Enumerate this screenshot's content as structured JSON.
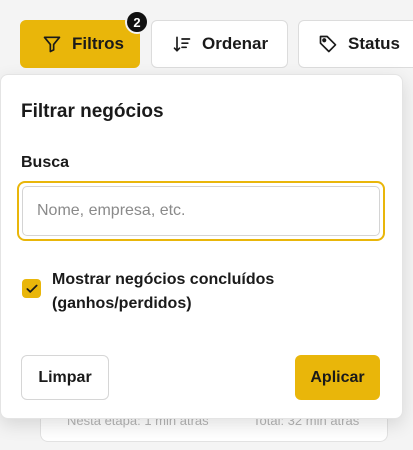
{
  "colors": {
    "accent": "#e9b60a",
    "badge": "#111111",
    "background": "#f4f4f4"
  },
  "toolbar": {
    "filters": {
      "label": "Filtros",
      "icon": "filter-icon",
      "badge_count": "2"
    },
    "sort": {
      "label": "Ordenar",
      "icon": "sort-icon"
    },
    "status": {
      "label": "Status",
      "icon": "tag-icon"
    }
  },
  "panel": {
    "title": "Filtrar negócios",
    "search": {
      "label": "Busca",
      "value": "",
      "placeholder": "Nome, empresa, etc."
    },
    "show_closed": {
      "checked": true,
      "label": "Mostrar negócios concluídos (ganhos/perdidos)"
    },
    "clear_label": "Limpar",
    "apply_label": "Aplicar"
  },
  "background_card": {
    "left_text": "Nesta etapa: 1 min atrás",
    "right_text": "Total: 32 min atrás"
  }
}
